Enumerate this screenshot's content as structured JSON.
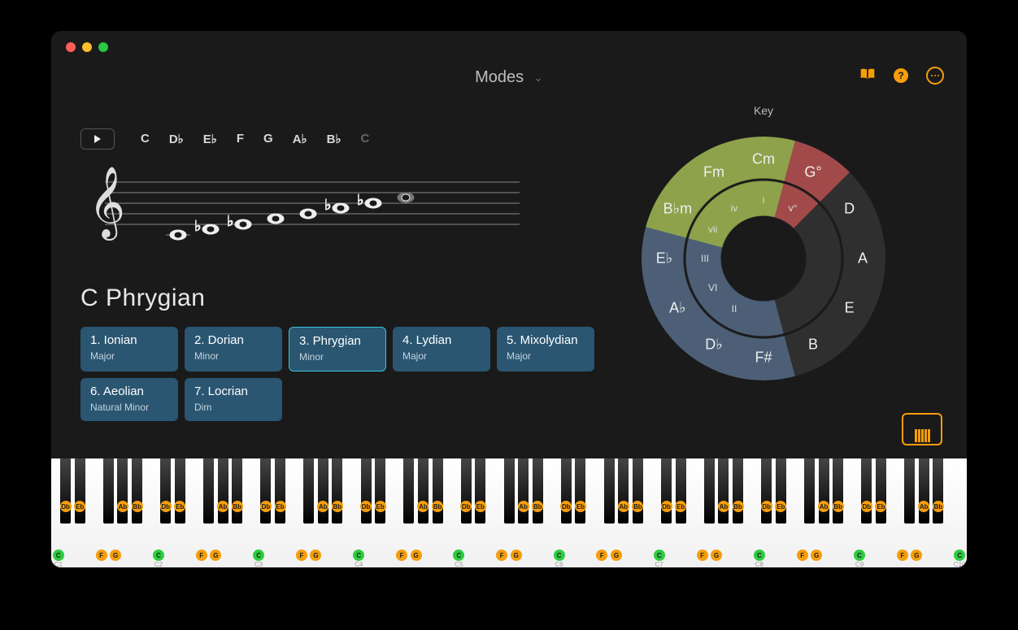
{
  "title_dropdown": "Modes",
  "play_notes": [
    "C",
    "D♭",
    "E♭",
    "F",
    "G",
    "A♭",
    "B♭"
  ],
  "play_notes_dim": "C",
  "mode_name": "C Phrygian",
  "wheel_title": "Key",
  "modes": [
    {
      "n": "1. Ionian",
      "s": "Major",
      "sel": false
    },
    {
      "n": "2. Dorian",
      "s": "Minor",
      "sel": false
    },
    {
      "n": "3. Phrygian",
      "s": "Minor",
      "sel": true
    },
    {
      "n": "4. Lydian",
      "s": "Major",
      "sel": false
    },
    {
      "n": "5. Mixolydian",
      "s": "Major",
      "sel": false
    },
    {
      "n": "6. Aeolian",
      "s": "Natural Minor",
      "sel": false
    },
    {
      "n": "7. Locrian",
      "s": "Dim",
      "sel": false
    }
  ],
  "wheel_outer": [
    {
      "t": "Cm",
      "a": 0
    },
    {
      "t": "G°",
      "a": 30
    },
    {
      "t": "D",
      "a": 60
    },
    {
      "t": "A",
      "a": 90
    },
    {
      "t": "E",
      "a": 120
    },
    {
      "t": "B",
      "a": 150
    },
    {
      "t": "F#",
      "a": 180
    },
    {
      "t": "D♭",
      "a": 210
    },
    {
      "t": "A♭",
      "a": 240
    },
    {
      "t": "E♭",
      "a": 270
    },
    {
      "t": "B♭m",
      "a": 300
    },
    {
      "t": "Fm",
      "a": 330
    }
  ],
  "wheel_inner": [
    {
      "t": "i",
      "a": 0
    },
    {
      "t": "v°",
      "a": 30
    },
    {
      "t": "II",
      "a": 210
    },
    {
      "t": "VI",
      "a": 240
    },
    {
      "t": "III",
      "a": 270
    },
    {
      "t": "vii",
      "a": 300
    },
    {
      "t": "iv",
      "a": 330
    }
  ],
  "piano": {
    "highlight_white": {
      "C": "green",
      "F": "orange",
      "G": "orange"
    },
    "highlight_black": {
      "Db": "orange",
      "Eb": "orange",
      "Ab": "orange",
      "Bb": "orange"
    },
    "octaves": 9,
    "start_label": "C1"
  }
}
